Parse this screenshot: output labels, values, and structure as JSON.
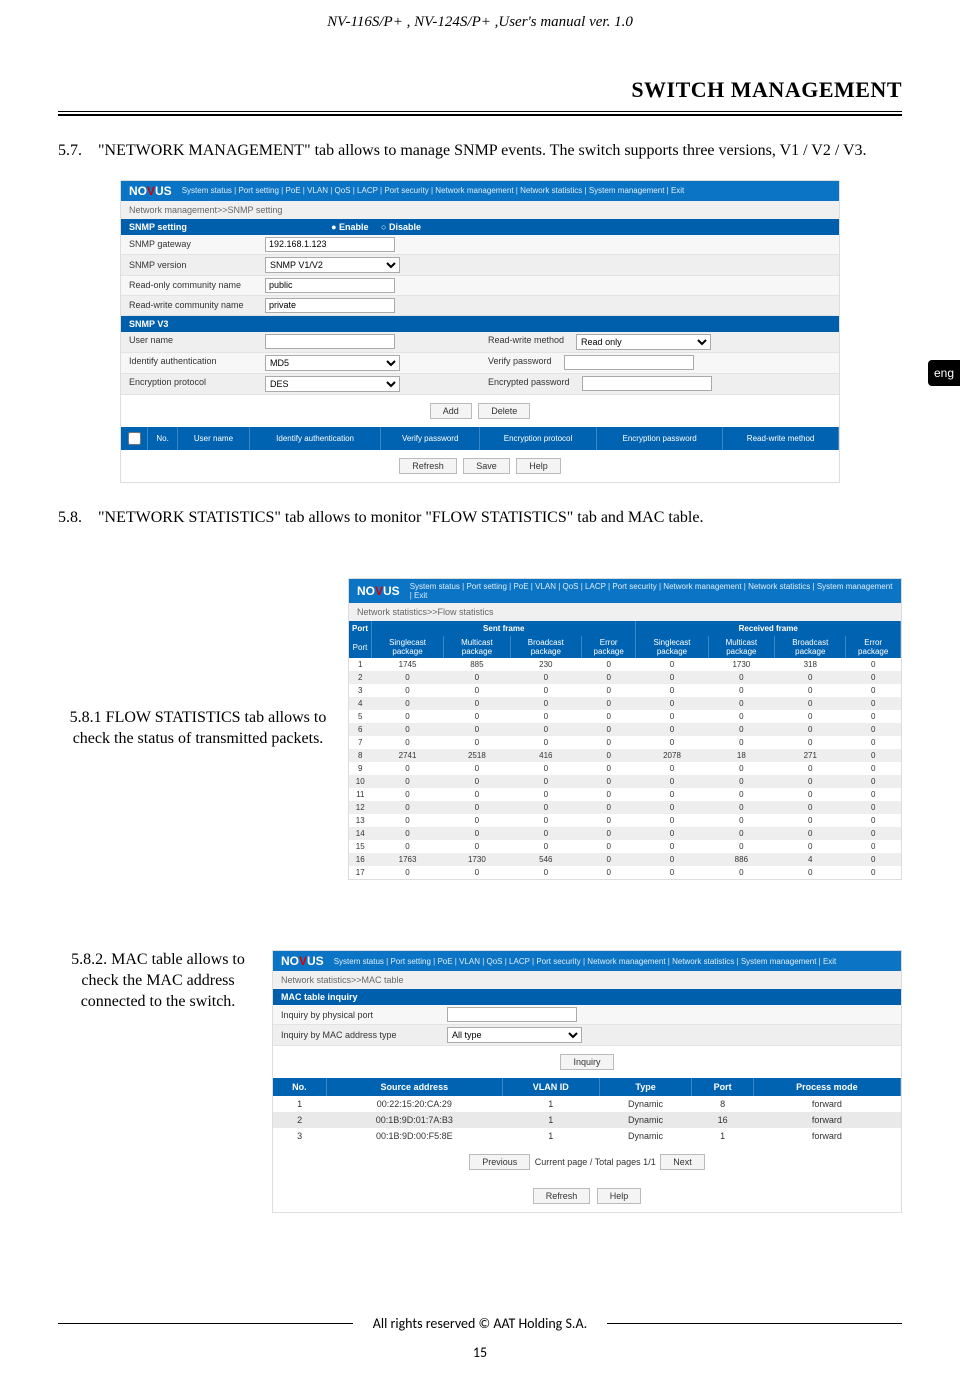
{
  "doc": {
    "header": "NV-116S/P+ , NV-124S/P+ ,User's manual ver. 1.0",
    "section_title": "SWITCH MANAGEMENT",
    "lang_tab": "eng",
    "p57_num": "5.7.",
    "p57": "\"NETWORK MANAGEMENT\" tab allows to manage SNMP events. The switch supports three versions, V1 / V2 / V3.",
    "p58_num": "5.8.",
    "p58": "\"NETWORK STATISTICS\" tab allows to monitor \"FLOW STATISTICS\" tab and MAC table.",
    "p581": "5.8.1  FLOW STATISTICS tab allows to check the status of transmitted packets.",
    "p582": "5.8.2. MAC table allows to check the MAC address connected to the switch.",
    "footer": "All rights reserved © AAT Holding S.A.",
    "page_num": "15"
  },
  "snmp": {
    "logo": "NOVUS",
    "menu": "System status | Port setting | PoE | VLAN | QoS | LACP | Port security | Network management | Network statistics | System management | Exit",
    "breadcrumb": "Network management>>SNMP setting",
    "head1": "SNMP setting",
    "enable": "Enable",
    "disable": "Disable",
    "rows": {
      "gateway_lab": "SNMP gateway",
      "gateway_val": "192.168.1.123",
      "version_lab": "SNMP version",
      "version_val": "SNMP V1/V2",
      "ro_lab": "Read-only community name",
      "ro_val": "public",
      "rw_lab": "Read-write community name",
      "rw_val": "private"
    },
    "head2": "SNMP V3",
    "v3": {
      "user_lab": "User name",
      "rw_method_lab": "Read-write method",
      "rw_method_val": "Read only",
      "ident_lab": "Identify authentication",
      "ident_val": "MD5",
      "verify_lab": "Verify password",
      "enc_lab": "Encryption protocol",
      "enc_val": "DES",
      "encpw_lab": "Encrypted password"
    },
    "btn_add": "Add",
    "btn_delete": "Delete",
    "cols": {
      "no": "No.",
      "user": "User name",
      "ident": "Identify authentication",
      "verify": "Verify password",
      "enc": "Encryption protocol",
      "encpw": "Encryption password",
      "rw": "Read-write method"
    },
    "btn_refresh": "Refresh",
    "btn_save": "Save",
    "btn_help": "Help"
  },
  "flow": {
    "breadcrumb": "Network statistics>>Flow statistics",
    "super_port": "Port",
    "super_sent": "Sent frame",
    "super_recv": "Received frame",
    "cols": {
      "port": "Port",
      "sc_s": "Singlecast package",
      "mc_s": "Multicast package",
      "bc_s": "Broadcast package",
      "err_s": "Error package",
      "sc_r": "Singlecast package",
      "mc_r": "Multicast package",
      "bc_r": "Broadcast package",
      "err_r": "Error package"
    },
    "rows": [
      [
        "1",
        "1745",
        "885",
        "230",
        "0",
        "0",
        "1730",
        "318",
        "0"
      ],
      [
        "2",
        "0",
        "0",
        "0",
        "0",
        "0",
        "0",
        "0",
        "0"
      ],
      [
        "3",
        "0",
        "0",
        "0",
        "0",
        "0",
        "0",
        "0",
        "0"
      ],
      [
        "4",
        "0",
        "0",
        "0",
        "0",
        "0",
        "0",
        "0",
        "0"
      ],
      [
        "5",
        "0",
        "0",
        "0",
        "0",
        "0",
        "0",
        "0",
        "0"
      ],
      [
        "6",
        "0",
        "0",
        "0",
        "0",
        "0",
        "0",
        "0",
        "0"
      ],
      [
        "7",
        "0",
        "0",
        "0",
        "0",
        "0",
        "0",
        "0",
        "0"
      ],
      [
        "8",
        "2741",
        "2518",
        "416",
        "0",
        "2078",
        "18",
        "271",
        "0"
      ],
      [
        "9",
        "0",
        "0",
        "0",
        "0",
        "0",
        "0",
        "0",
        "0"
      ],
      [
        "10",
        "0",
        "0",
        "0",
        "0",
        "0",
        "0",
        "0",
        "0"
      ],
      [
        "11",
        "0",
        "0",
        "0",
        "0",
        "0",
        "0",
        "0",
        "0"
      ],
      [
        "12",
        "0",
        "0",
        "0",
        "0",
        "0",
        "0",
        "0",
        "0"
      ],
      [
        "13",
        "0",
        "0",
        "0",
        "0",
        "0",
        "0",
        "0",
        "0"
      ],
      [
        "14",
        "0",
        "0",
        "0",
        "0",
        "0",
        "0",
        "0",
        "0"
      ],
      [
        "15",
        "0",
        "0",
        "0",
        "0",
        "0",
        "0",
        "0",
        "0"
      ],
      [
        "16",
        "1763",
        "1730",
        "546",
        "0",
        "0",
        "886",
        "4",
        "0"
      ],
      [
        "17",
        "0",
        "0",
        "0",
        "0",
        "0",
        "0",
        "0",
        "0"
      ]
    ]
  },
  "mac": {
    "breadcrumb": "Network statistics>>MAC table",
    "head": "MAC table inquiry",
    "phys_lab": "Inquiry by physical port",
    "type_lab": "Inquiry by MAC address type",
    "type_val": "All type",
    "btn_inquiry": "Inquiry",
    "cols": {
      "no": "No.",
      "src": "Source address",
      "vlan": "VLAN ID",
      "type": "Type",
      "port": "Port",
      "mode": "Process mode"
    },
    "rows": [
      [
        "1",
        "00:22:15:20:CA:29",
        "1",
        "Dynamic",
        "8",
        "forward"
      ],
      [
        "2",
        "00:1B:9D:01:7A:B3",
        "1",
        "Dynamic",
        "16",
        "forward"
      ],
      [
        "3",
        "00:1B:9D:00:F5:8E",
        "1",
        "Dynamic",
        "1",
        "forward"
      ]
    ],
    "btn_prev": "Previous",
    "pager": "Current page / Total pages 1/1",
    "btn_next": "Next",
    "btn_refresh": "Refresh",
    "btn_help": "Help"
  }
}
